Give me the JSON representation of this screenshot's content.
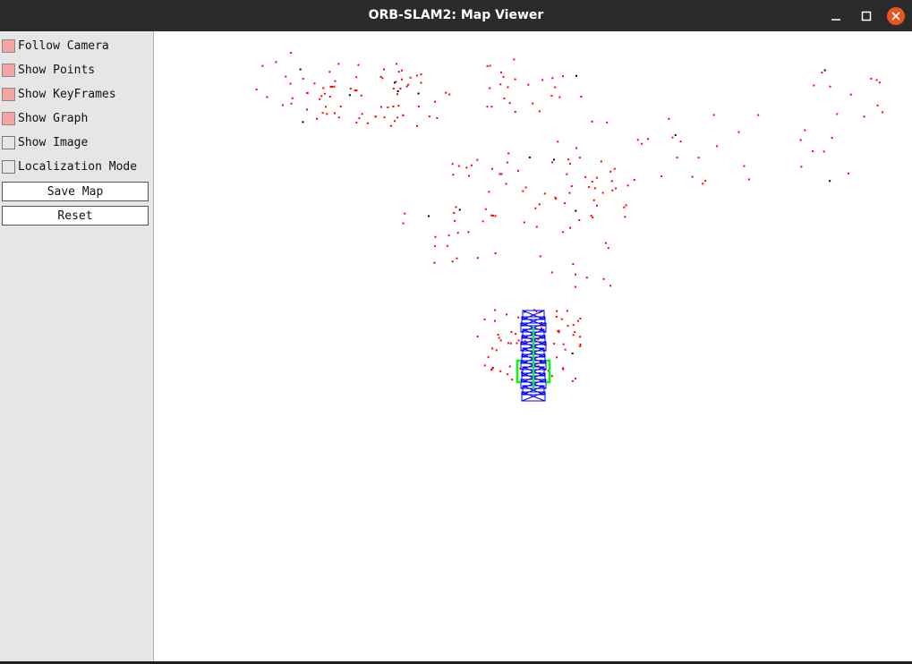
{
  "window": {
    "title": "ORB-SLAM2: Map Viewer",
    "buttons": {
      "minimize_icon": "minimize-icon",
      "maximize_icon": "maximize-icon",
      "close_icon": "close-icon"
    }
  },
  "panel": {
    "checkboxes": [
      {
        "label": "Follow Camera",
        "checked": true
      },
      {
        "label": "Show Points",
        "checked": true
      },
      {
        "label": "Show KeyFrames",
        "checked": true
      },
      {
        "label": "Show Graph",
        "checked": true
      },
      {
        "label": "Show Image",
        "checked": false
      },
      {
        "label": "Localization Mode",
        "checked": false
      }
    ],
    "buttons": {
      "save_map": "Save Map",
      "reset": "Reset"
    }
  },
  "map": {
    "point_color": "#ff0000",
    "reference_point_color": "#000000",
    "keyframe_color": "#0000ff",
    "current_camera_color": "#00ff00"
  }
}
